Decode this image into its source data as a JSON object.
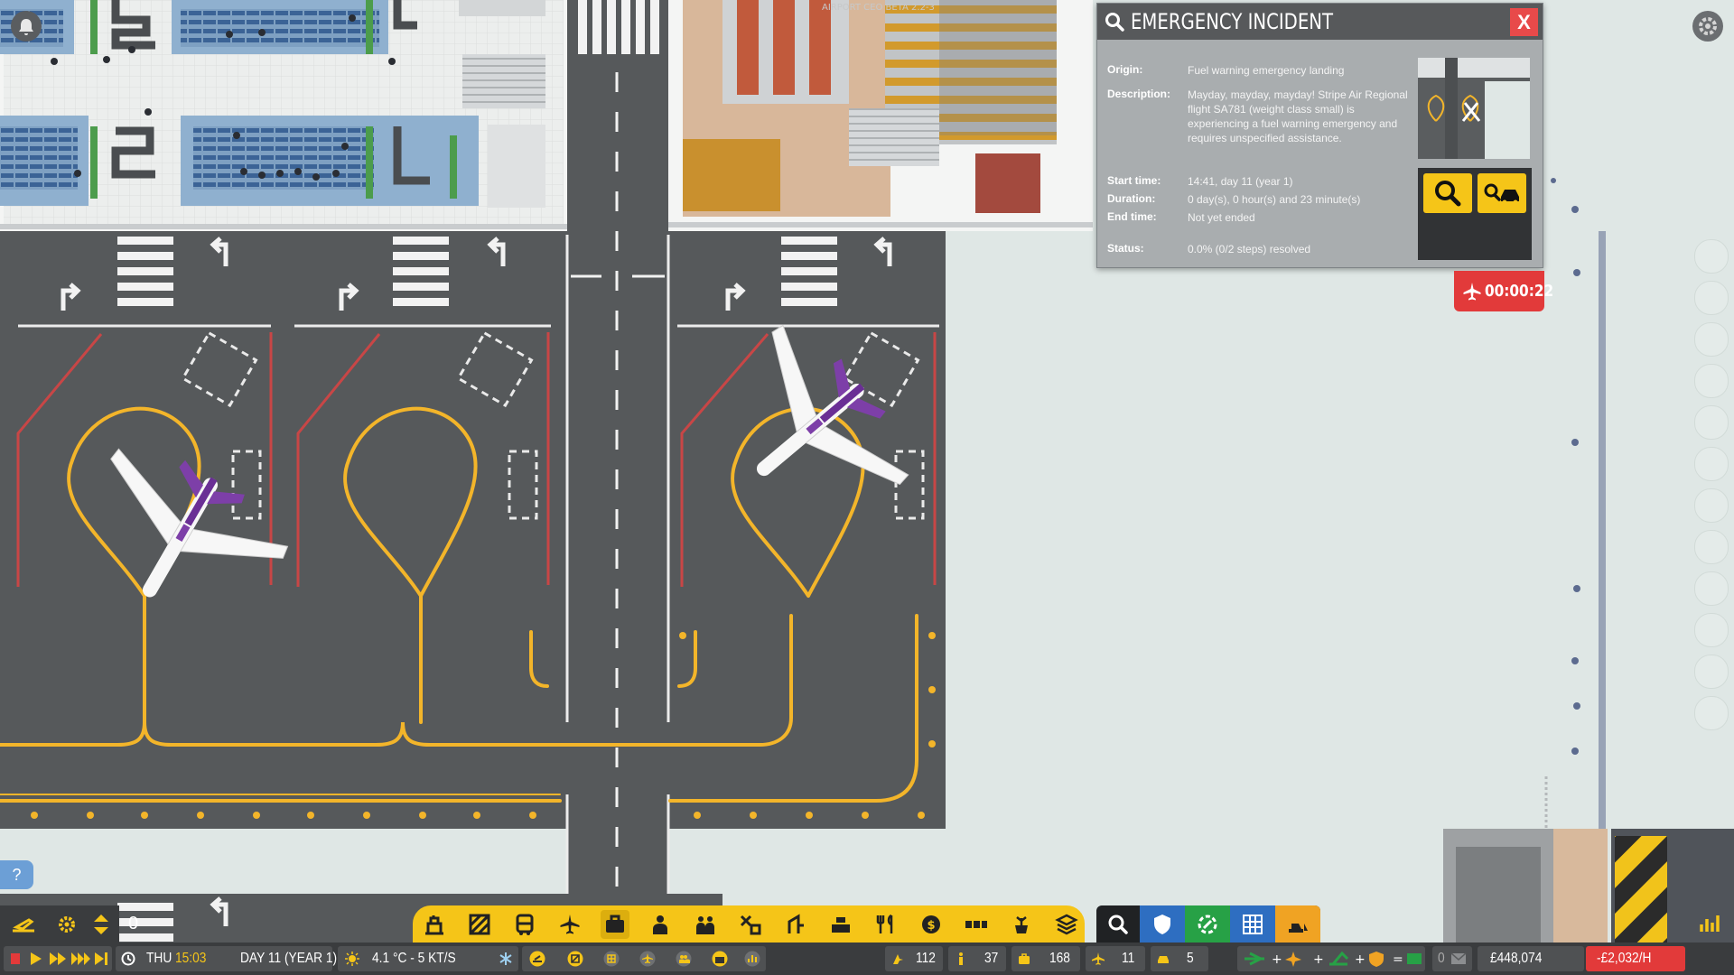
{
  "version_watermark": "AIRPORT CEO BETA 2.2-3",
  "incident": {
    "title": "EMERGENCY INCIDENT",
    "close_label": "X",
    "fields": [
      {
        "label": "Origin:",
        "value": "Fuel warning emergency landing"
      },
      {
        "label": "Description:",
        "value": "Mayday, mayday, mayday! Stripe Air Regional flight SA781 (weight class small) is experiencing a fuel warning emergency and requires unspecified assistance."
      },
      {
        "label": "Start time:",
        "value": "14:41, day 11 (year 1)"
      },
      {
        "label": "Duration:",
        "value": "0 day(s), 0 hour(s) and 23 minute(s)"
      },
      {
        "label": "End time:",
        "value": "Not yet ended"
      },
      {
        "label": "Status:",
        "value": "0.0% (0/2 steps) resolved"
      }
    ],
    "timer": "00:00:22"
  },
  "hud": {
    "help_label": "?",
    "layer_value": "0",
    "day": "THU",
    "time": "15:03",
    "date": "DAY 11 (YEAR 1)",
    "weather": "4.1 °C - 5 KT/S",
    "stats": {
      "passengers": "112",
      "staff": "37",
      "bags": "168",
      "flights": "11",
      "vehicles": "5"
    },
    "money": "£448,074",
    "rate": "-£2,032/H",
    "mail_count": "0"
  },
  "colors": {
    "accent": "#f5c518",
    "alert": "#e23a3a",
    "tarmac": "#56595b",
    "taxi_line": "#f3b52a"
  },
  "icons": [
    "bell-icon",
    "gear-icon",
    "search-icon",
    "car-search-icon",
    "airplane-icon",
    "clock-icon",
    "sun-icon",
    "snowflake-icon",
    "money-icon",
    "mail-icon",
    "chart-icon"
  ]
}
